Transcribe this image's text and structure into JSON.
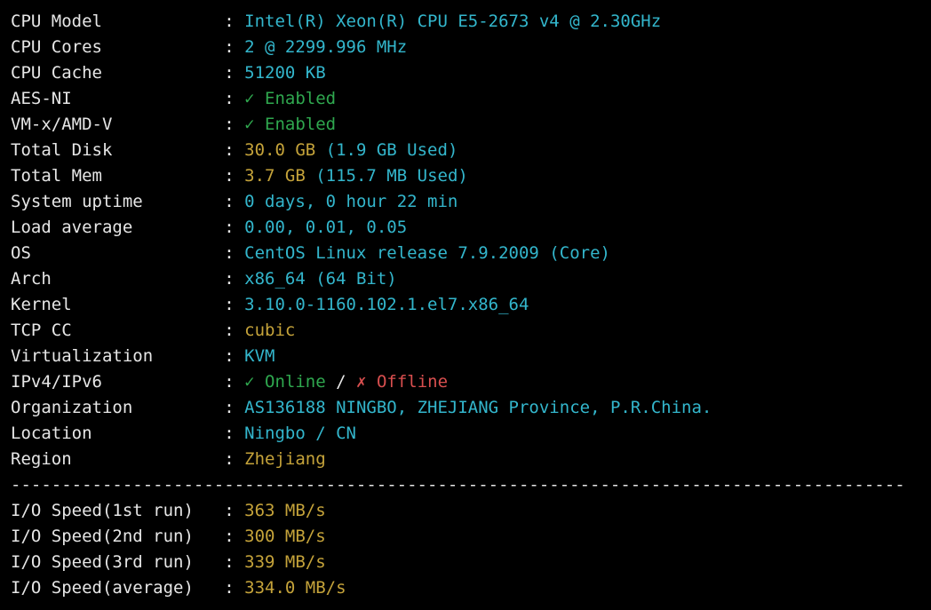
{
  "labels": {
    "cpu_model": "CPU Model",
    "cpu_cores": "CPU Cores",
    "cpu_cache": "CPU Cache",
    "aes_ni": "AES-NI",
    "vmx": "VM-x/AMD-V",
    "total_disk": "Total Disk",
    "total_mem": "Total Mem",
    "uptime": "System uptime",
    "loadavg": "Load average",
    "os": "OS",
    "arch": "Arch",
    "kernel": "Kernel",
    "tcpcc": "TCP CC",
    "virt": "Virtualization",
    "ipv": "IPv4/IPv6",
    "org": "Organization",
    "loc": "Location",
    "region": "Region",
    "io1": "I/O Speed(1st run)",
    "io2": "I/O Speed(2nd run)",
    "io3": "I/O Speed(3rd run)",
    "ioavg": "I/O Speed(average)"
  },
  "values": {
    "cpu_model": "Intel(R) Xeon(R) CPU E5-2673 v4 @ 2.30GHz",
    "cpu_cores": "2 @ 2299.996 MHz",
    "cpu_cache": "51200 KB",
    "aes_check": "✓",
    "aes_text": "Enabled",
    "vmx_check": "✓",
    "vmx_text": "Enabled",
    "disk_size": "30.0 GB",
    "disk_used": "(1.9 GB Used)",
    "mem_size": "3.7 GB",
    "mem_used": "(115.7 MB Used)",
    "uptime": "0 days, 0 hour 22 min",
    "loadavg": "0.00, 0.01, 0.05",
    "os": "CentOS Linux release 7.9.2009 (Core)",
    "arch": "x86_64 (64 Bit)",
    "kernel": "3.10.0-1160.102.1.el7.x86_64",
    "tcpcc": "cubic",
    "virt": "KVM",
    "ipv4_check": "✓",
    "ipv4_text": "Online",
    "ipv_sep": "/",
    "ipv6_check": "✗",
    "ipv6_text": "Offline",
    "org": "AS136188 NINGBO, ZHEJIANG Province, P.R.China.",
    "loc": "Ningbo / CN",
    "region": "Zhejiang",
    "io1": "363 MB/s",
    "io2": "300 MB/s",
    "io3": "339 MB/s",
    "ioavg": "334.0 MB/s"
  },
  "sep": ":",
  "divider_char": "-"
}
